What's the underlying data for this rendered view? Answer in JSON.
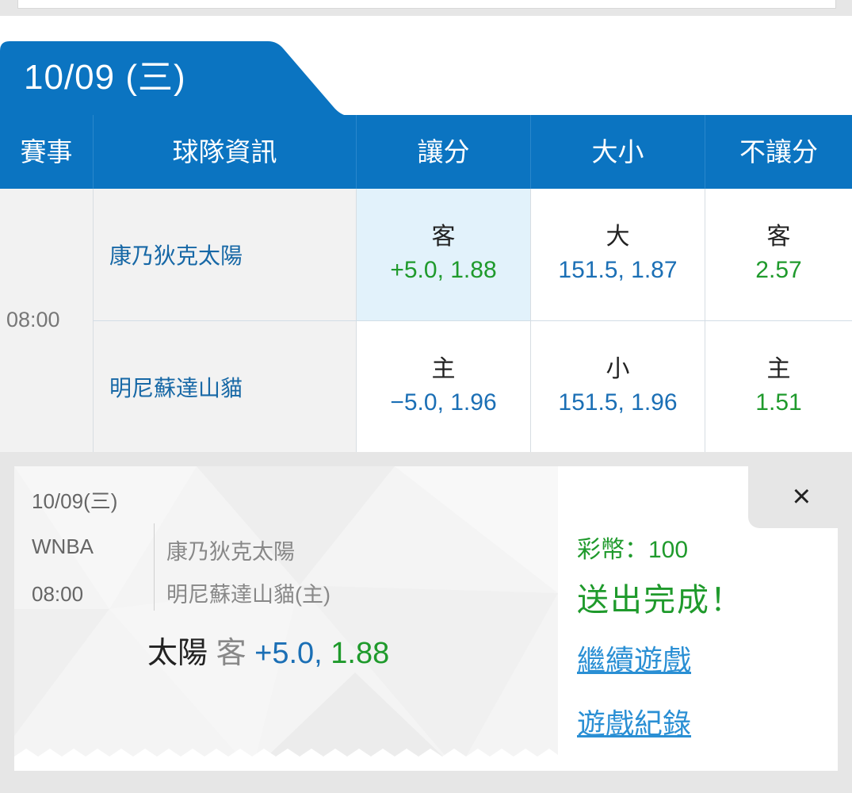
{
  "date_tab": {
    "label": "10/09 (三)"
  },
  "header": {
    "columns": [
      "賽事",
      "球隊資訊",
      "讓分",
      "大小",
      "不讓分"
    ]
  },
  "game": {
    "time": "08:00",
    "rows": [
      {
        "team": "康乃狄克太陽",
        "spread": {
          "label": "客",
          "value": "+5.0, 1.88"
        },
        "total": {
          "label": "大",
          "value": "151.5, 1.87"
        },
        "moneyline": {
          "label": "客",
          "value": "2.57"
        }
      },
      {
        "team": "明尼蘇達山貓",
        "spread": {
          "label": "主",
          "value": "−5.0, 1.96"
        },
        "total": {
          "label": "小",
          "value": "151.5, 1.96"
        },
        "moneyline": {
          "label": "主",
          "value": "1.51"
        }
      }
    ]
  },
  "ticket": {
    "date": "10/09(三)",
    "league": "WNBA",
    "time": "08:00",
    "team_away": "康乃狄克太陽",
    "team_home": "明尼蘇達山貓(主)",
    "bet_team": "太陽",
    "bet_side": "客",
    "bet_line": "+5.0,",
    "bet_odds": "1.88"
  },
  "result": {
    "close_icon": "×",
    "coins": "彩幣：100",
    "status": "送出完成！",
    "continue_link": "繼續遊戲",
    "history_link": "遊戲紀錄"
  },
  "colors": {
    "primary_blue": "#0b74c1",
    "odds_green": "#1f9a2c",
    "odds_blue": "#1b6fb5",
    "link_blue": "#2a8fd4",
    "selected_bg": "#e2f2fb"
  }
}
